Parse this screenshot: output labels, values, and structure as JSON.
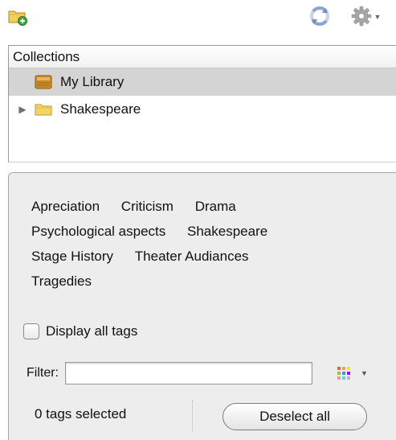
{
  "toolbar": {
    "new_collection_icon": "folder-add-icon",
    "sync_icon": "sync-icon",
    "actions_icon": "gear-icon"
  },
  "collections": {
    "header": "Collections",
    "items": [
      {
        "label": "My Library",
        "icon": "library-icon",
        "selected": true,
        "expandable": false
      },
      {
        "label": "Shakespeare",
        "icon": "folder-icon",
        "selected": false,
        "expandable": true
      }
    ]
  },
  "tag_selector": {
    "tags": [
      "Apreciation",
      "Criticism",
      "Drama",
      "Psychological aspects",
      "Shakespeare",
      "Stage History",
      "Theater Audiances",
      "Tragedies"
    ],
    "display_all_label": "Display all tags",
    "display_all_checked": false,
    "filter_label": "Filter:",
    "filter_value": "",
    "selected_count_text": "0 tags selected",
    "deselect_label": "Deselect all"
  },
  "colors": {
    "selection": "#d4d4d4",
    "pane_background": "#ededed",
    "folder_yellow": "#f2c94c",
    "library_brown": "#c98a2a"
  }
}
